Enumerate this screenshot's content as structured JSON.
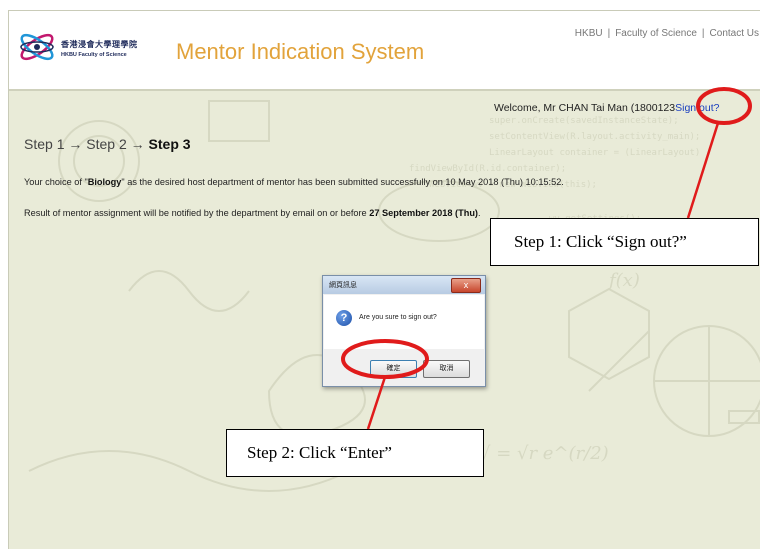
{
  "header": {
    "logo_chinese": "香港浸會大學理學院",
    "logo_english": "HKBU Faculty of Science",
    "app_title": "Mentor Indication System",
    "links": [
      "HKBU",
      "Faculty of Science",
      "Contact Us"
    ],
    "link_separator": "|"
  },
  "welcome": {
    "text": "Welcome, Mr CHAN Tai Man (1800123",
    "signout_label": "Sign out?"
  },
  "steps": {
    "step1": "Step 1",
    "step2": "Step 2",
    "step3": "Step 3",
    "arrow": "→"
  },
  "messages": {
    "line1_pre": "Your choice of \"",
    "line1_bold": "Biology",
    "line1_post": "\" as the desired host department of mentor has been submitted successfully on 10 May 2018 (Thu) 10:15:52.",
    "line2_pre": "Result of mentor assignment will be notified by the department by email on or before ",
    "line2_bold": "27 September 2018 (Thu)",
    "line2_post": "."
  },
  "dialog": {
    "title": "網頁訊息",
    "close_icon": "x",
    "question_icon": "?",
    "question": "Are you sure to sign out?",
    "ok_label": "確定",
    "cancel_label": "取消"
  },
  "annotations": {
    "callout1": "Step 1: Click “Sign out?”",
    "callout2": "Step 2: Click “Enter”",
    "highlight_color": "#e01b1b"
  },
  "colors": {
    "title_orange": "#e2a33b",
    "background": "#e9ebd8",
    "link_blue": "#1a3fbf"
  }
}
